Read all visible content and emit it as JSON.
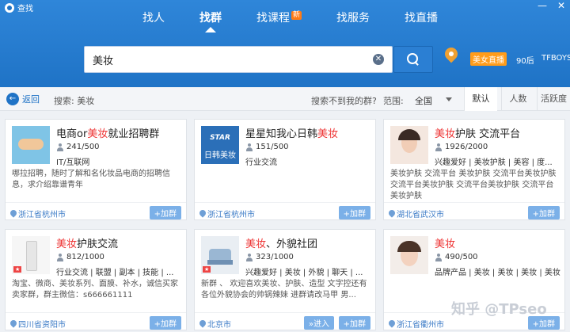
{
  "window": {
    "title": "查找"
  },
  "nav": {
    "tabs": [
      {
        "label": "找人"
      },
      {
        "label": "找群"
      },
      {
        "label": "找课程",
        "badge": "新"
      },
      {
        "label": "找服务"
      },
      {
        "label": "找直播"
      }
    ],
    "active": "找群"
  },
  "search": {
    "value": "美妆"
  },
  "promo": {
    "live_label": "美女直播",
    "label_90": "90后",
    "label_tfboys": "TFBOYS"
  },
  "filter": {
    "back_label": "返回",
    "summary": "搜索: 美妆",
    "not_found": "搜索不到我的群?",
    "range_label": "范围:",
    "range_value": "全国",
    "sort_tabs": [
      "默认",
      "人数",
      "活跃度"
    ]
  },
  "cards": [
    {
      "title_pre": "电商or",
      "title_hl": "美妆",
      "title_post": "就业招聘群",
      "members": "241/500",
      "tags": "IT/互联网",
      "desc": "哪拉招聘，随时了解和名化妆品电商的招聘信息，求介绍靠谱青年",
      "location": "浙江省杭州市",
      "join": "+加群"
    },
    {
      "title_pre": "星星知我心日韩",
      "title_hl": "美妆",
      "title_post": "",
      "members": "151/500",
      "tags": "行业交流",
      "desc": "",
      "location": "浙江省杭州市",
      "join": "+加群",
      "avatar_line1": "STAR",
      "avatar_line2": "日韩美妆"
    },
    {
      "title_pre": "",
      "title_hl": "美妆",
      "title_post": "护肤 交流平台",
      "members": "1926/2000",
      "tags": "兴趣爱好 | 美妆护肤 | 美容 | 度...",
      "desc": "美妆护肤 交流平台 美妆护肤 交流平台美妆护肤 交流平台美妆护肤 交流平台美妆护肤 交流平台美妆护肤",
      "location": "湖北省武汉市",
      "join": "+加群"
    },
    {
      "title_pre": "",
      "title_hl": "美妆",
      "title_post": "护肤交流",
      "members": "812/1000",
      "tags": "行业交流 | 联盟 | 副本 | 技能 | ...",
      "desc": "淘宝、微商、美妆系列、面膜、补水，诚信买家卖家群，群主微信：s666661111",
      "location": "四川省资阳市",
      "join": "+加群"
    },
    {
      "title_pre": "",
      "title_hl": "美妆",
      "title_post": "、外貌社团",
      "members": "323/1000",
      "tags": "兴趣爱好 | 美妆 | 外貌 | 聊天 | ...",
      "desc": "新群 、 欢迎喜欢美妆、护肤、造型 文字控还有各位外貌协会的帅锅辣妹 进群请改马甲 男...",
      "location": "北京市",
      "join": "+加群",
      "enter": "»进入"
    },
    {
      "title_pre": "",
      "title_hl": "美妆",
      "title_post": "",
      "members": "490/500",
      "tags": "品牌产品 | 美妆 | 美妆 | 美妆 | 美妆",
      "desc": "",
      "location": "浙江省衢州市",
      "join": "+加群"
    }
  ],
  "watermark": "知乎 @TPseo"
}
